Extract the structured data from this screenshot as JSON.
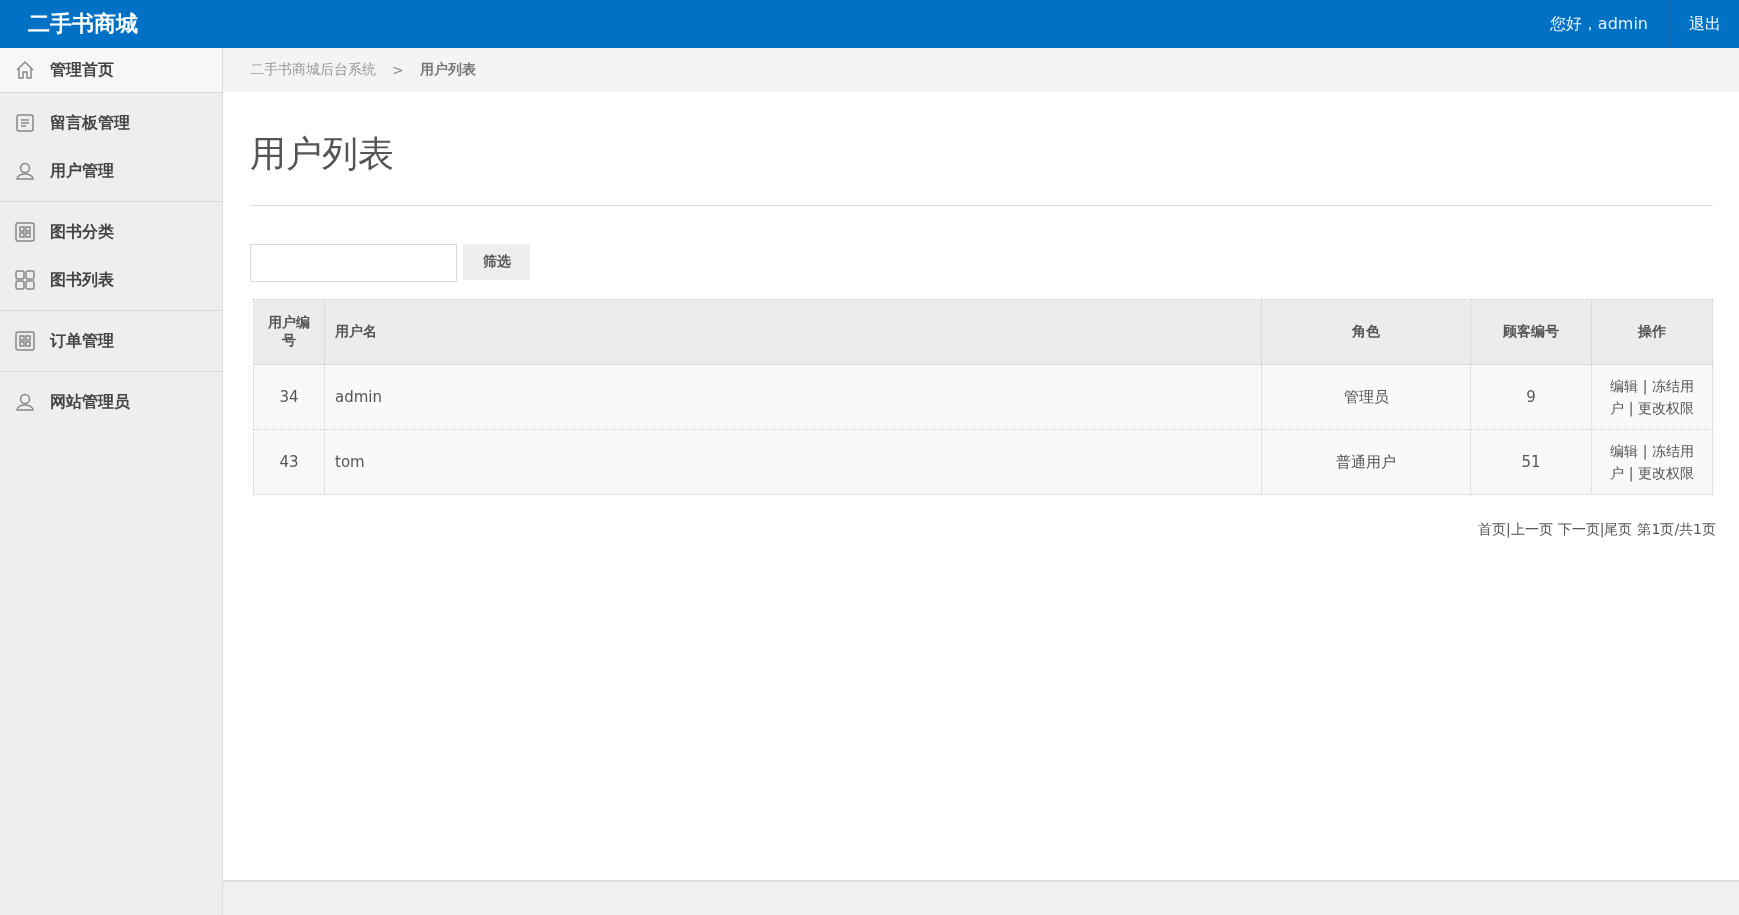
{
  "header": {
    "brand": "二手书商城",
    "greeting": "您好，admin",
    "logout": "退出"
  },
  "sidebar": {
    "groups": [
      {
        "items": [
          {
            "label": "管理首页"
          }
        ]
      },
      {
        "items": [
          {
            "label": "留言板管理"
          },
          {
            "label": "用户管理"
          }
        ]
      },
      {
        "items": [
          {
            "label": "图书分类"
          },
          {
            "label": "图书列表"
          }
        ]
      },
      {
        "items": [
          {
            "label": "订单管理"
          }
        ]
      },
      {
        "items": [
          {
            "label": "网站管理员"
          }
        ]
      }
    ]
  },
  "breadcrumb": {
    "root": "二手书商城后台系统",
    "separator": ">",
    "current": "用户列表"
  },
  "page_title": "用户列表",
  "filter": {
    "button": "筛选"
  },
  "table": {
    "columns": [
      "用户编号",
      "用户名",
      "角色",
      "顾客编号",
      "操作"
    ],
    "rows": [
      {
        "cells": [
          "34",
          "admin",
          "管理员",
          "9"
        ],
        "actions": "编辑 | 冻结用户 | 更改权限"
      },
      {
        "cells": [
          "43",
          "tom",
          "普通用户",
          "51"
        ],
        "actions": "编辑 | 冻结用户 | 更改权限"
      }
    ]
  },
  "pagination": {
    "items": [
      {
        "kind": "link",
        "text": "首页"
      },
      {
        "kind": "separator",
        "text": "|"
      },
      {
        "kind": "link",
        "text": "上一页"
      },
      {
        "kind": "link",
        "text": "下一页"
      },
      {
        "kind": "separator",
        "text": "|"
      },
      {
        "kind": "link",
        "text": "尾页"
      },
      {
        "kind": "info",
        "text": "第1页/共1页"
      }
    ]
  }
}
